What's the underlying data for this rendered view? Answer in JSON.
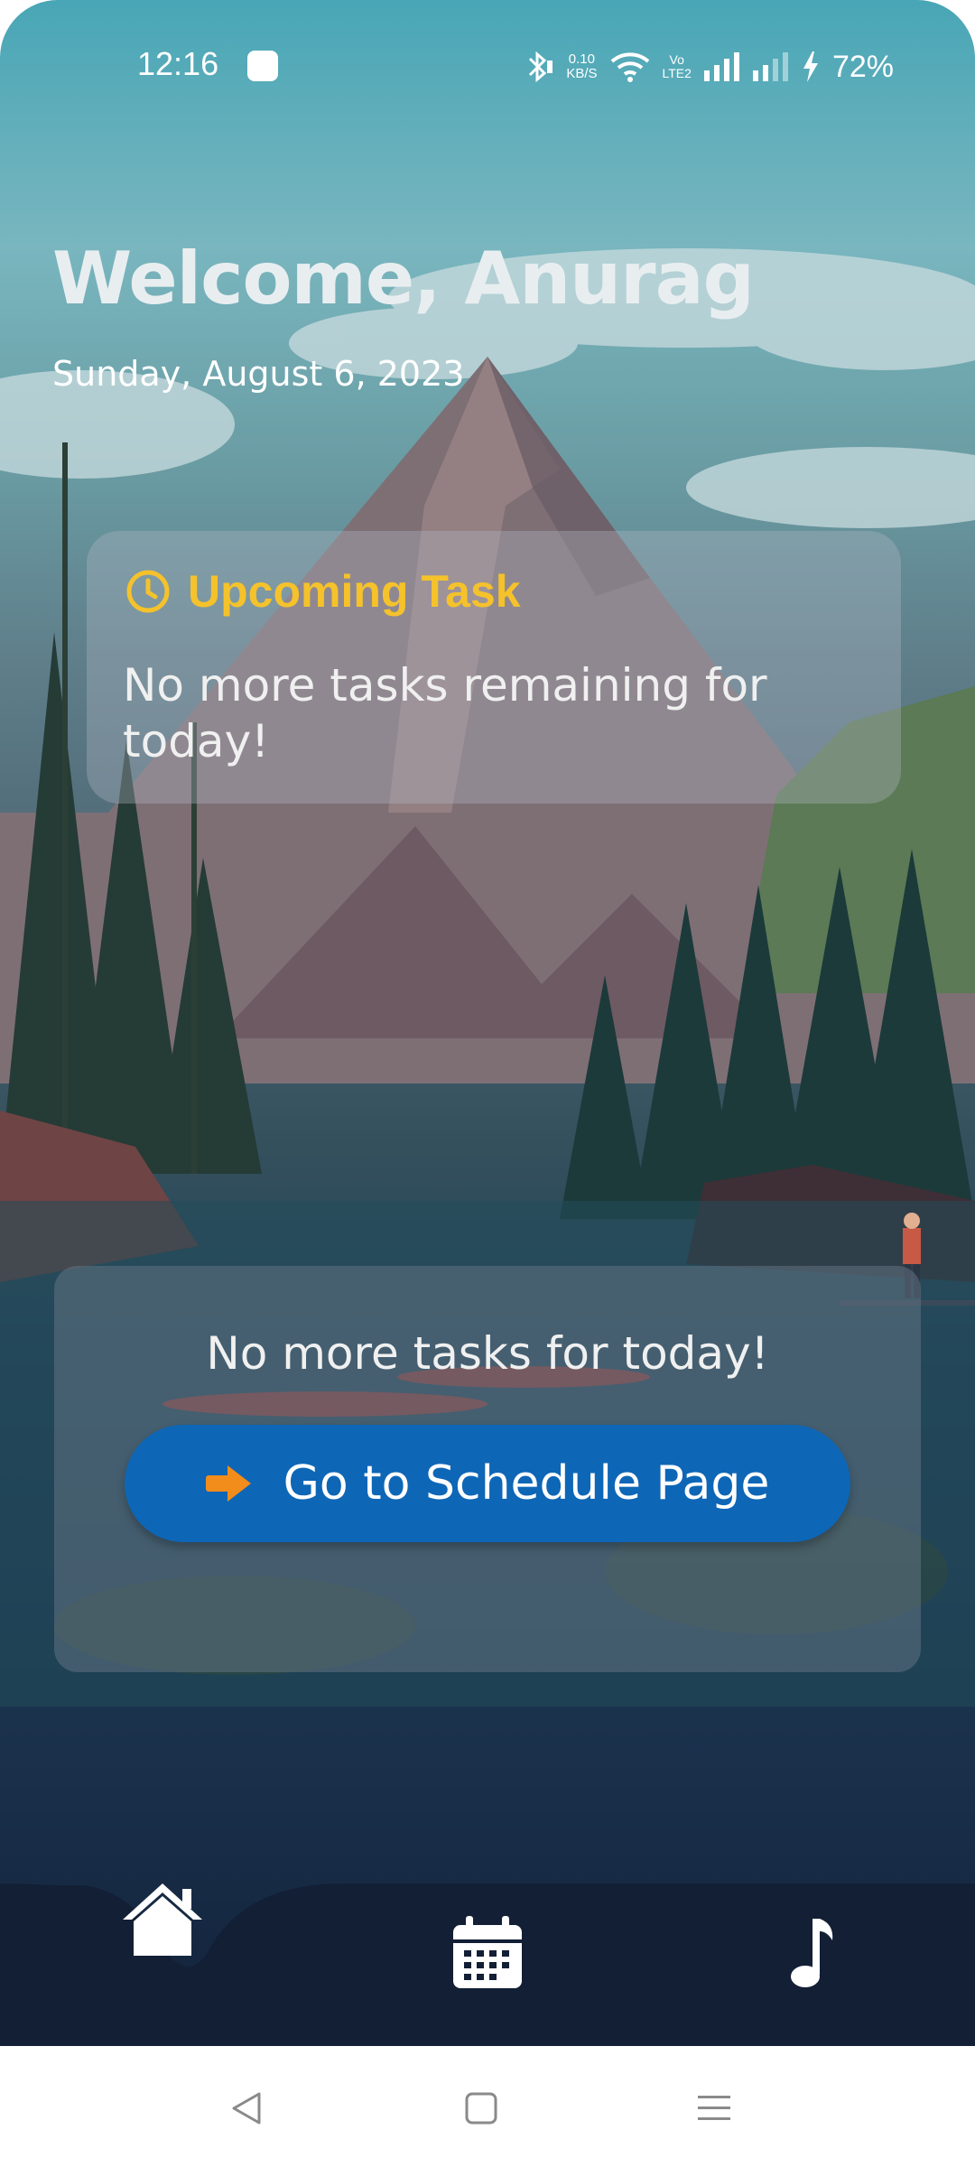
{
  "status_bar": {
    "time": "12:16",
    "net_speed_value": "0.10",
    "net_speed_unit": "KB/S",
    "volte_top": "Vo",
    "volte_bottom": "LTE2",
    "battery": "72%"
  },
  "header": {
    "welcome": "Welcome, Anurag",
    "date": "Sunday, August 6, 2023"
  },
  "upcoming_card": {
    "title": "Upcoming Task",
    "message": "No more tasks remaining for today!"
  },
  "schedule_card": {
    "message": "No more tasks for today!",
    "button_label": "Go to Schedule Page"
  },
  "bottom_nav": {
    "items": [
      {
        "icon": "home-icon",
        "active": true
      },
      {
        "icon": "calendar-icon",
        "active": false
      },
      {
        "icon": "music-note-icon",
        "active": false
      }
    ]
  },
  "system_nav": {
    "buttons": [
      "back-icon",
      "home-square-icon",
      "menu-icon"
    ]
  },
  "colors": {
    "accent_yellow": "#f5c22b",
    "button_blue": "#0e66b6",
    "arrow_orange": "#f28c1b",
    "nav_bar": "#121f35"
  }
}
